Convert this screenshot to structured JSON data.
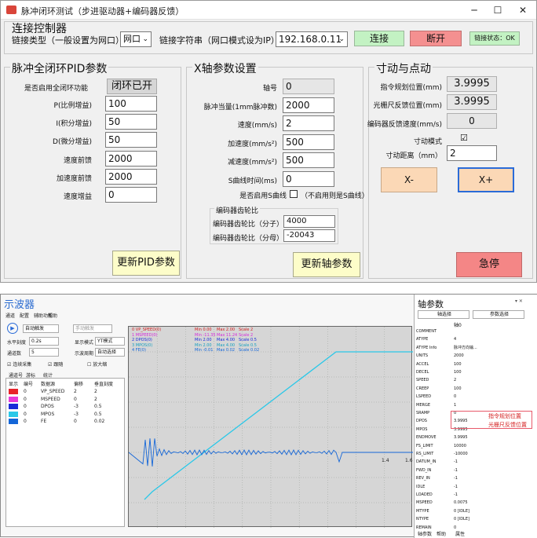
{
  "window": {
    "title": "脉冲闭环测试（步进驱动器+编码器反馈）",
    "min": "─",
    "max": "☐",
    "close": "✕"
  },
  "connection": {
    "title": "连接控制器",
    "type_label": "链接类型（一般设置为网口）",
    "type_value": "网口",
    "ip_label": "链接字符串（网口模式设为IP）",
    "ip_value": "192.168.0.11",
    "connect_btn": "连接",
    "disconnect_btn": "断开",
    "status": "链接状态：OK"
  },
  "pid": {
    "title": "脉冲全闭环PID参数",
    "enable_label": "是否启用全闭环功能",
    "enable_btn": "闭环已开",
    "fields": [
      {
        "label": "P(比例增益)",
        "value": "100"
      },
      {
        "label": "I(积分增益)",
        "value": "50"
      },
      {
        "label": "D(微分增益)",
        "value": "50"
      },
      {
        "label": "速度前馈",
        "value": "2000"
      },
      {
        "label": "加速度前馈",
        "value": "2000"
      },
      {
        "label": "速度增益",
        "value": "0"
      }
    ],
    "update_btn": "更新PID参数"
  },
  "axis_set": {
    "title": "X轴参数设置",
    "fields": [
      {
        "label": "轴号",
        "value": "0",
        "ro": true
      },
      {
        "label": "脉冲当量(1mm脉冲数)",
        "value": "2000",
        "ro": false
      },
      {
        "label": "速度(mm/s)",
        "value": "2",
        "ro": false
      },
      {
        "label": "加速度(mm/s²)",
        "value": "500",
        "ro": false
      },
      {
        "label": "减速度(mm/s²)",
        "value": "500",
        "ro": false
      },
      {
        "label": "S曲线时间(ms)",
        "value": "0",
        "ro": false
      }
    ],
    "s_curve_label": "是否启用S曲线",
    "s_curve_hint": "（不启用则是S曲线）",
    "gear_title": "编码器齿轮比",
    "gear_num_label": "编码器齿轮比（分子）",
    "gear_num_value": "4000",
    "gear_den_label": "编码器齿轮比（分母）",
    "gear_den_value": "-20043",
    "update_btn": "更新轴参数"
  },
  "jog": {
    "title": "寸动与点动",
    "cmd_pos_label": "指令规划位置(mm)",
    "cmd_pos_value": "3.9995",
    "grating_label": "光栅尺反馈位置(mm)",
    "grating_value": "3.9995",
    "enc_speed_label": "编码器反馈速度(mm/s)",
    "enc_speed_value": "0",
    "inch_mode_label": "寸动模式",
    "inch_mode_check": "☑",
    "inch_dist_label": "寸动距离（mm）",
    "inch_dist_value": "2",
    "xminus_btn": "X-",
    "xplus_btn": "X+",
    "estop_btn": "急停"
  },
  "scope": {
    "title": "示波器",
    "menu": [
      "通道",
      "配置",
      "辅助功能",
      "帮助"
    ],
    "trigger_mode": "自动触发",
    "manual_trigger": "手动触发",
    "h_scale_label": "水平刻度",
    "h_scale_value": "0.2s",
    "display_mode_label": "显示模式",
    "display_mode_value": "YT模式",
    "channels_label": "通道数",
    "channels_value": "5",
    "sample_label": "示波周期",
    "sample_value": "自动选择",
    "cont_label": "连续采集",
    "follow_label": "跟随",
    "zoom_label": "放大缩",
    "tabs": [
      "通道号",
      "游标",
      "统计"
    ],
    "table_head": [
      "显示",
      "编号",
      "数据源",
      "偏移",
      "垂直刻度"
    ],
    "table_rows": [
      {
        "color": "#e8232a",
        "no": "0",
        "src": "VP_SPEED",
        "off": "2",
        "scale": "2"
      },
      {
        "color": "#e83ad8",
        "no": "0",
        "src": "MSPEED",
        "off": "0",
        "scale": "2"
      },
      {
        "color": "#1a2bd8",
        "no": "0",
        "src": "DPOS",
        "off": "-3",
        "scale": "0.5"
      },
      {
        "color": "#2ac8e8",
        "no": "0",
        "src": "MPOS",
        "off": "-3",
        "scale": "0.5"
      },
      {
        "color": "#1466d8",
        "no": "0",
        "src": "FE",
        "off": "0",
        "scale": "0.02"
      }
    ],
    "legend": [
      {
        "name": "0 VP_SPEED(0)",
        "min": "Min 0.00",
        "max": "Max 2.00",
        "scale": "Scale 2",
        "color": "#d42020"
      },
      {
        "name": "1 MSPEED(0)",
        "min": "Min -11.35",
        "max": "Max 11.24",
        "scale": "Scale 2",
        "color": "#d42adb"
      },
      {
        "name": "2 DPOS(0)",
        "min": "Min 2.00",
        "max": "Max 4.00",
        "scale": "Scale 0.5",
        "color": "#1a2bd8"
      },
      {
        "name": "3 MPOS(0)",
        "min": "Min 2.00",
        "max": "Max 4.00",
        "scale": "Scale 0.5",
        "color": "#16a0c0"
      },
      {
        "name": "4 FE(0)",
        "min": "Min -0.01",
        "max": "Max 0.02",
        "scale": "Scale 0.02",
        "color": "#1466d8"
      }
    ],
    "xticks": [
      "1.4",
      "1.6"
    ]
  },
  "axis_params": {
    "title": "轴参数",
    "tabs": [
      "轴选择",
      "参数选择"
    ],
    "col_head": "轴0",
    "rows": [
      {
        "k": "COMMENT",
        "v": ""
      },
      {
        "k": "ATYPE",
        "v": "4"
      },
      {
        "k": "ATYPE Info",
        "v": "脉冲方向输..."
      },
      {
        "k": "UNITS",
        "v": "2000"
      },
      {
        "k": "ACCEL",
        "v": "100"
      },
      {
        "k": "DECEL",
        "v": "100"
      },
      {
        "k": "SPEED",
        "v": "2"
      },
      {
        "k": "CREEP",
        "v": "100"
      },
      {
        "k": "LSPEED",
        "v": "0"
      },
      {
        "k": "MERGE",
        "v": "1"
      },
      {
        "k": "SRAMP",
        "v": "0"
      },
      {
        "k": "DPOS",
        "v": "3.9995"
      },
      {
        "k": "MPOS",
        "v": "3.9995"
      },
      {
        "k": "ENDMOVE",
        "v": "3.9995"
      },
      {
        "k": "FS_LIMIT",
        "v": "10000"
      },
      {
        "k": "RS_LIMIT",
        "v": "-10000"
      },
      {
        "k": "DATUM_IN",
        "v": "-1"
      },
      {
        "k": "FWD_IN",
        "v": "-1"
      },
      {
        "k": "REV_IN",
        "v": "-1"
      },
      {
        "k": "IDLE",
        "v": "-1"
      },
      {
        "k": "LOADED",
        "v": "-1"
      },
      {
        "k": "MSPEED",
        "v": "0.0075"
      },
      {
        "k": "MTYPE",
        "v": "0 [IDLE]"
      },
      {
        "k": "NTYPE",
        "v": "0 [IDLE]"
      },
      {
        "k": "REMAIN",
        "v": "0"
      }
    ],
    "note1": "指令规划位置",
    "note2": "光栅尺反馈位置",
    "bottom_tabs": [
      "轴参数",
      "帮助",
      "属性"
    ]
  }
}
